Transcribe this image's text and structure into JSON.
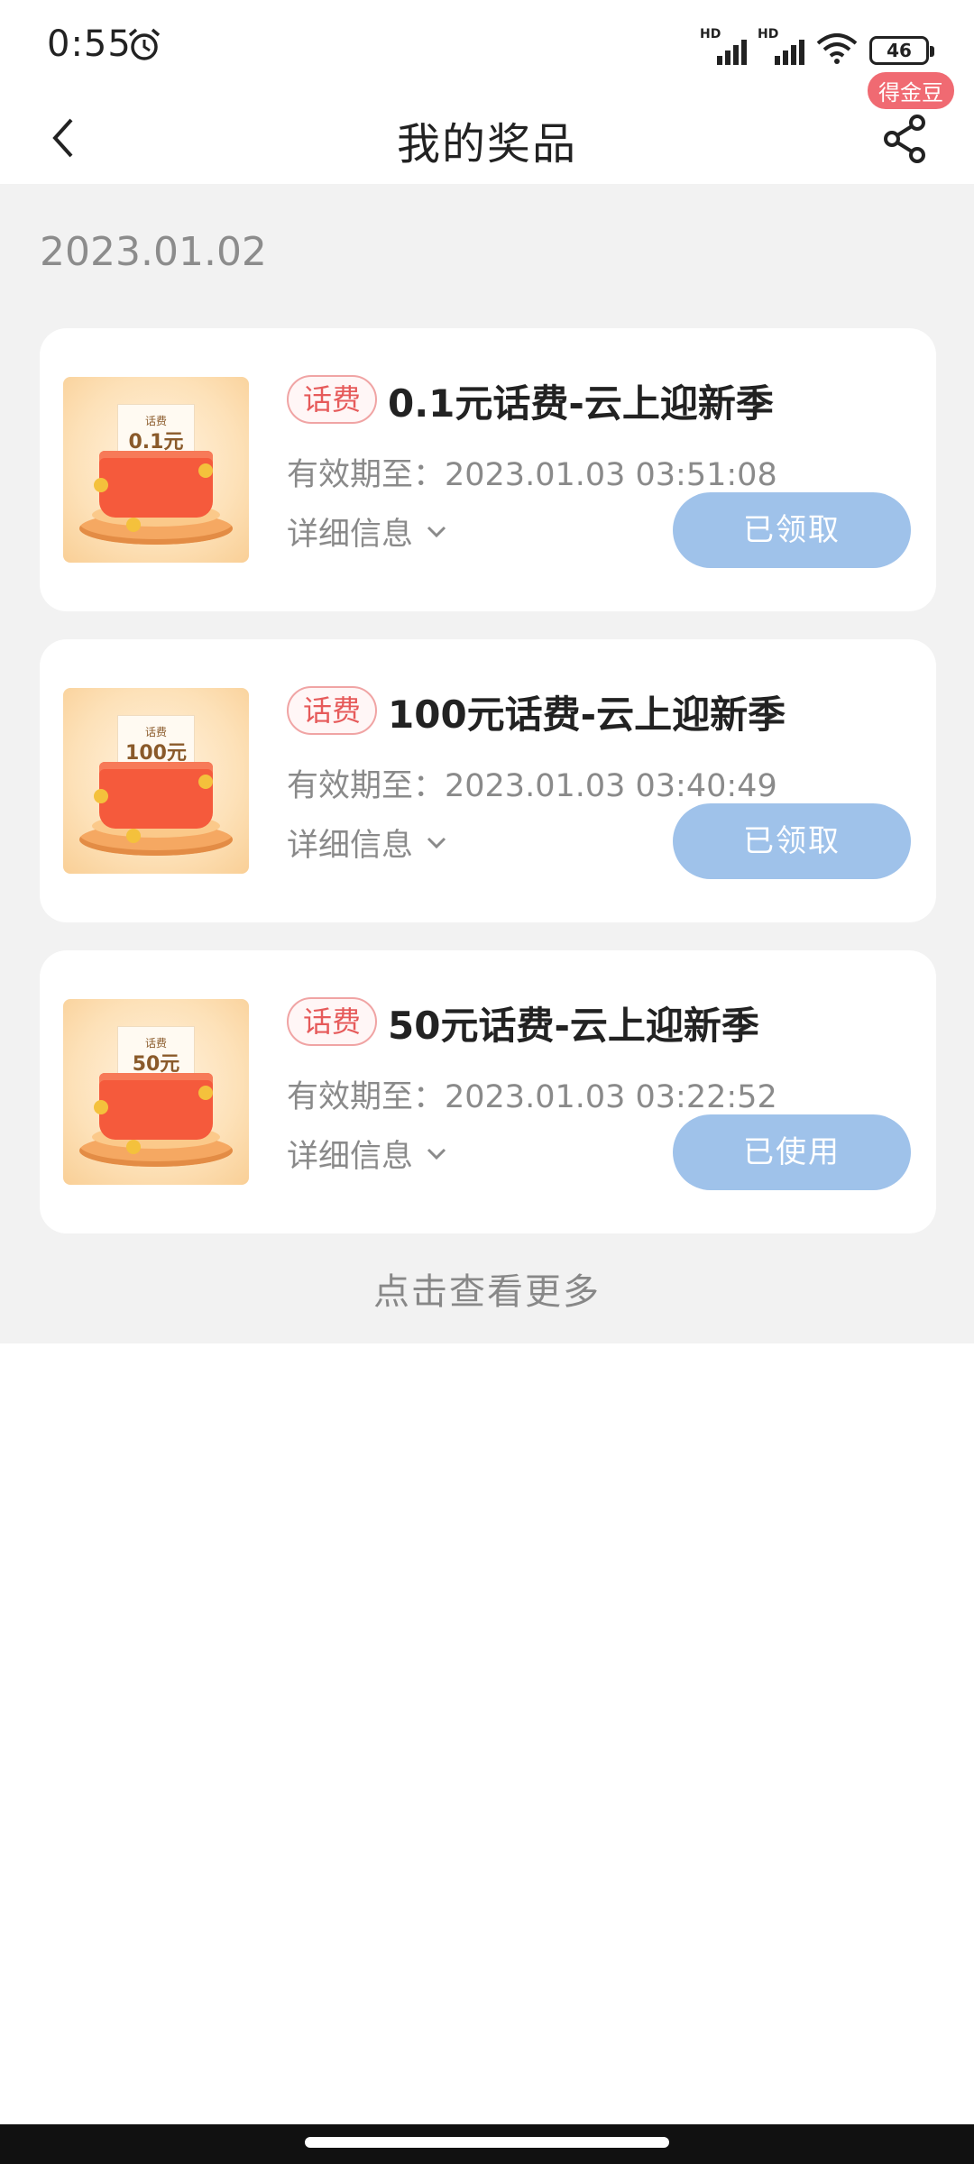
{
  "status_bar": {
    "time": "0:55",
    "signal1_label": "HD",
    "signal2_label": "HD",
    "battery": "46"
  },
  "nav": {
    "title": "我的奖品",
    "badge": "得金豆"
  },
  "date_header": "2023.01.02",
  "prizes": [
    {
      "tag": "话费",
      "title": "0.1元话费-云上迎新季",
      "expiry": "有效期至：2023.01.03 03:51:08",
      "detail": "详细信息",
      "status": "已领取",
      "thumb_label": "话费",
      "thumb_amount": "0.1元"
    },
    {
      "tag": "话费",
      "title": "100元话费-云上迎新季",
      "expiry": "有效期至：2023.01.03 03:40:49",
      "detail": "详细信息",
      "status": "已领取",
      "thumb_label": "话费",
      "thumb_amount": "100元"
    },
    {
      "tag": "话费",
      "title": "50元话费-云上迎新季",
      "expiry": "有效期至：2023.01.03 03:22:52",
      "detail": "详细信息",
      "status": "已使用",
      "thumb_label": "话费",
      "thumb_amount": "50元"
    }
  ],
  "more_link": "点击查看更多",
  "colors": {
    "accent_tag": "#e65a5a",
    "status_button": "#9fc2ea",
    "badge": "#f06a72",
    "background": "#f2f2f2"
  }
}
